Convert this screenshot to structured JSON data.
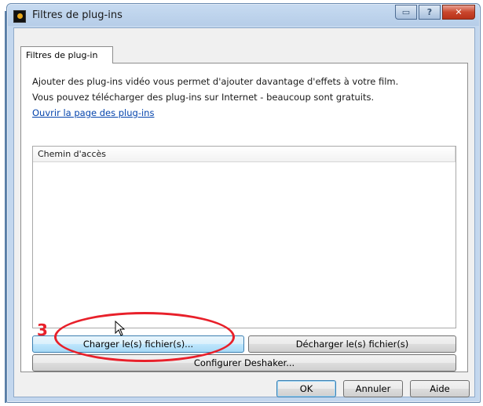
{
  "window": {
    "title": "Filtres de plug-ins",
    "min_glyph": "▭",
    "help_glyph": "?",
    "close_glyph": "✕"
  },
  "tabs": [
    {
      "label": "Filtres de plug-in"
    }
  ],
  "panel": {
    "line1": "Ajouter des plug-ins vidéo vous permet d'ajouter davantage d'effets à votre film.",
    "line2": "Vous pouvez télécharger des plug-ins sur Internet - beaucoup sont gratuits.",
    "link": "Ouvrir la page des plug-ins",
    "list": {
      "columns": [
        "Chemin d'accès"
      ],
      "rows": []
    },
    "buttons": {
      "load": "Charger le(s) fichier(s)...",
      "unload": "Décharger le(s) fichier(s)",
      "configure": "Configurer Deshaker..."
    }
  },
  "footer": {
    "ok": "OK",
    "cancel": "Annuler",
    "help": "Aide"
  },
  "annotation": {
    "number": "3",
    "color": "#e8202a"
  },
  "icons": {
    "app": "film-icon",
    "cursor": "mouse-pointer-icon"
  }
}
